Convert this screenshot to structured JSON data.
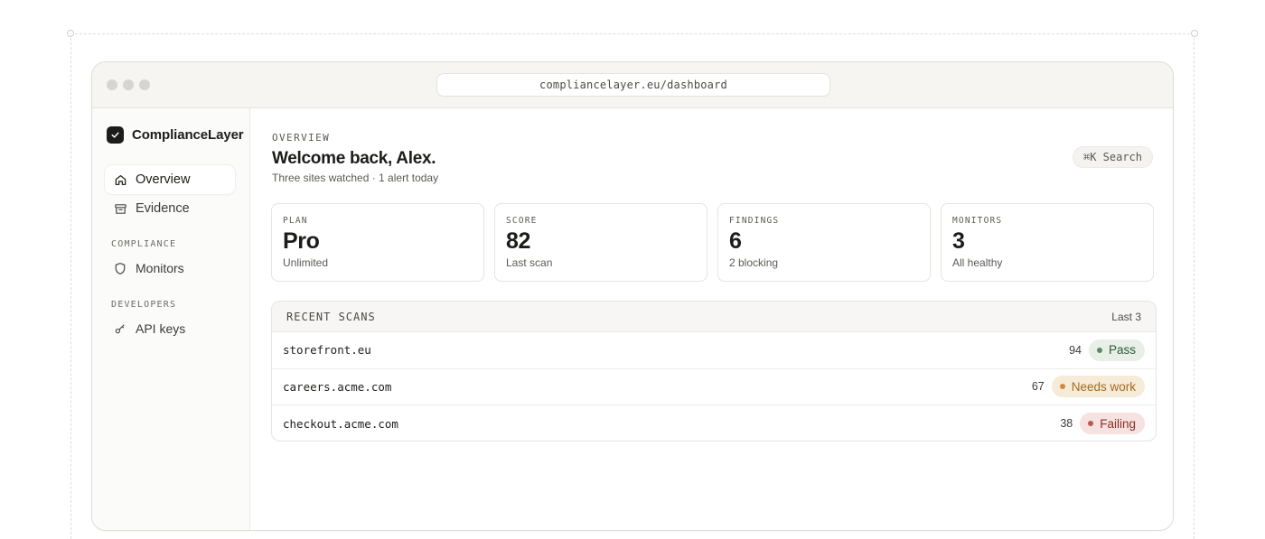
{
  "browser": {
    "url": "compliancelayer.eu/dashboard"
  },
  "sidebar": {
    "brand": "ComplianceLayer",
    "items": [
      {
        "label": "Overview",
        "icon": "home-icon",
        "active": true
      },
      {
        "label": "Evidence",
        "icon": "archive-icon",
        "active": false
      }
    ],
    "sections": [
      {
        "title": "COMPLIANCE",
        "items": [
          {
            "label": "Monitors",
            "icon": "shield-icon"
          }
        ]
      },
      {
        "title": "DEVELOPERS",
        "items": [
          {
            "label": "API keys",
            "icon": "key-icon"
          }
        ]
      }
    ]
  },
  "header": {
    "eyebrow": "OVERVIEW",
    "title": "Welcome back, Alex.",
    "subtitle": "Three sites watched · 1 alert today",
    "search_label": "⌘K Search"
  },
  "stats": [
    {
      "label": "PLAN",
      "value": "Pro",
      "sub": "Unlimited"
    },
    {
      "label": "SCORE",
      "value": "82",
      "sub": "Last scan"
    },
    {
      "label": "FINDINGS",
      "value": "6",
      "sub": "2 blocking"
    },
    {
      "label": "MONITORS",
      "value": "3",
      "sub": "All healthy"
    }
  ],
  "scans": {
    "title": "RECENT SCANS",
    "range": "Last 3",
    "rows": [
      {
        "host": "storefront.eu",
        "score": "94",
        "status": "Pass"
      },
      {
        "host": "careers.acme.com",
        "score": "67",
        "status": "Needs work"
      },
      {
        "host": "checkout.acme.com",
        "score": "38",
        "status": "Failing"
      }
    ]
  },
  "colors": {
    "pass_bg": "#e7efe7",
    "pass_fg": "#2f5a36",
    "pass_dot": "#5c8a64",
    "warn_bg": "#f6ead8",
    "warn_fg": "#a46a1f",
    "warn_dot": "#d08a3a",
    "fail_bg": "#f6e2e0",
    "fail_fg": "#8a2f28",
    "fail_dot": "#c0574e"
  }
}
